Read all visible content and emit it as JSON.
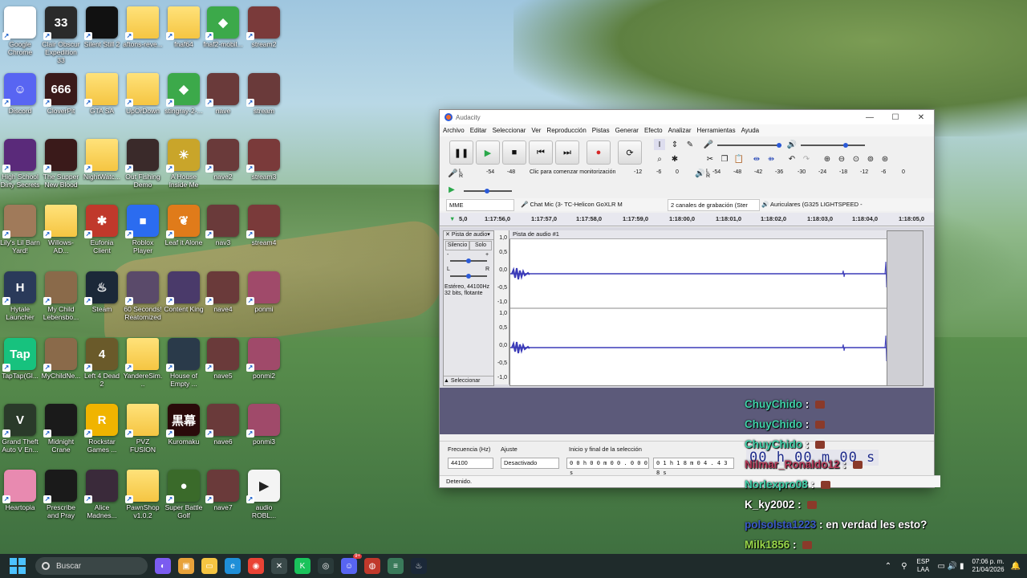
{
  "desktop": {
    "icons": [
      {
        "label": "Google Chrome",
        "color": "#ffffff",
        "glyph": "◉",
        "icon": "chrome-icon"
      },
      {
        "label": "Clair Obscur Expedition 33",
        "color": "#2a2a2a",
        "glyph": "33",
        "icon": "game-icon"
      },
      {
        "label": "Silent Still 2",
        "color": "#111111",
        "glyph": "",
        "icon": "game-icon"
      },
      {
        "label": "aftons-reve...",
        "color": "#f5c542",
        "glyph": "",
        "icon": "folder-icon"
      },
      {
        "label": "fnaf64",
        "color": "#f5c542",
        "glyph": "",
        "icon": "folder-icon"
      },
      {
        "label": "fnaf2-mobil...",
        "color": "#3ca94a",
        "glyph": "◆",
        "icon": "bluestacks-icon"
      },
      {
        "label": "stream2",
        "color": "#7a3a3a",
        "glyph": "",
        "icon": "video-icon"
      },
      {
        "label": "Discord",
        "color": "#5865f2",
        "glyph": "☺",
        "icon": "discord-icon"
      },
      {
        "label": "CloverPit",
        "color": "#3a1a1a",
        "glyph": "666",
        "icon": "game-icon"
      },
      {
        "label": "GTA SA",
        "color": "#f5c542",
        "glyph": "",
        "icon": "folder-icon"
      },
      {
        "label": "UpOrDown",
        "color": "#f5c542",
        "glyph": "",
        "icon": "folder-icon"
      },
      {
        "label": "stingray-2-...",
        "color": "#3ca94a",
        "glyph": "◆",
        "icon": "bluestacks-icon"
      },
      {
        "label": "nave",
        "color": "#6a3a3a",
        "glyph": "",
        "icon": "video-icon"
      },
      {
        "label": "stream",
        "color": "#6a3a3a",
        "glyph": "",
        "icon": "video-icon"
      },
      {
        "label": "High School Dirty Secrets",
        "color": "#5a2a7a",
        "glyph": "",
        "icon": "game-icon"
      },
      {
        "label": "The Supper New Blood",
        "color": "#3a1a1a",
        "glyph": "",
        "icon": "game-icon"
      },
      {
        "label": "NightWatc...",
        "color": "#f5c542",
        "glyph": "",
        "icon": "folder-icon"
      },
      {
        "label": "Out Fishing Demo",
        "color": "#3a2a2a",
        "glyph": "",
        "icon": "game-icon"
      },
      {
        "label": "A House Inside Me",
        "color": "#c9a52a",
        "glyph": "☀",
        "icon": "game-icon"
      },
      {
        "label": "nave2",
        "color": "#6a3a3a",
        "glyph": "",
        "icon": "video-icon"
      },
      {
        "label": "stream3",
        "color": "#7a3a3a",
        "glyph": "",
        "icon": "video-icon"
      },
      {
        "label": "Lily's Lil Barn Yard!",
        "color": "#a07a5a",
        "glyph": "",
        "icon": "game-icon"
      },
      {
        "label": "Willows-AD...",
        "color": "#f5c542",
        "glyph": "",
        "icon": "folder-icon"
      },
      {
        "label": "Eufonia Client",
        "color": "#c0392b",
        "glyph": "✱",
        "icon": "game-icon"
      },
      {
        "label": "Roblox Player",
        "color": "#2b6cf0",
        "glyph": "■",
        "icon": "roblox-icon"
      },
      {
        "label": "Leaf it Alone",
        "color": "#e07b1a",
        "glyph": "❦",
        "icon": "game-icon"
      },
      {
        "label": "nav3",
        "color": "#6a3a3a",
        "glyph": "",
        "icon": "video-icon"
      },
      {
        "label": "stream4",
        "color": "#7a3a3a",
        "glyph": "",
        "icon": "video-icon"
      },
      {
        "label": "Hytale Launcher",
        "color": "#2a3a5a",
        "glyph": "H",
        "icon": "game-icon"
      },
      {
        "label": "My Child Lebensbo...",
        "color": "#8a6a4a",
        "glyph": "",
        "icon": "game-icon"
      },
      {
        "label": "Steam",
        "color": "#1b2838",
        "glyph": "♨",
        "icon": "steam-icon"
      },
      {
        "label": "60 Seconds! Reatomized",
        "color": "#5a4a6a",
        "glyph": "",
        "icon": "game-icon"
      },
      {
        "label": "Content King",
        "color": "#4a3a6a",
        "glyph": "",
        "icon": "game-icon"
      },
      {
        "label": "nave4",
        "color": "#6a3a3a",
        "glyph": "",
        "icon": "video-icon"
      },
      {
        "label": "ponmi",
        "color": "#a04a6a",
        "glyph": "",
        "icon": "video-icon"
      },
      {
        "label": "TapTap(Gl...",
        "color": "#17c27e",
        "glyph": "Tap",
        "icon": "taptap-icon"
      },
      {
        "label": "MyChildNe...",
        "color": "#8a6a4a",
        "glyph": "",
        "icon": "game-icon"
      },
      {
        "label": "Left 4 Dead 2",
        "color": "#6a5a2a",
        "glyph": "4",
        "icon": "game-icon"
      },
      {
        "label": "YandereSim...",
        "color": "#f5c542",
        "glyph": "",
        "icon": "folder-icon"
      },
      {
        "label": "House of Empty ...",
        "color": "#2a3a4a",
        "glyph": "",
        "icon": "game-icon"
      },
      {
        "label": "nave5",
        "color": "#6a3a3a",
        "glyph": "",
        "icon": "video-icon"
      },
      {
        "label": "ponmi2",
        "color": "#a04a6a",
        "glyph": "",
        "icon": "video-icon"
      },
      {
        "label": "Grand Theft Auto V En...",
        "color": "#2a3a2a",
        "glyph": "V",
        "icon": "game-icon"
      },
      {
        "label": "Midnight Crane",
        "color": "#1a1a1a",
        "glyph": "",
        "icon": "game-icon"
      },
      {
        "label": "Rockstar Games ...",
        "color": "#f0b400",
        "glyph": "R",
        "icon": "rockstar-icon"
      },
      {
        "label": "PVZ FUSION",
        "color": "#f5c542",
        "glyph": "",
        "icon": "folder-icon"
      },
      {
        "label": "Kuromaku",
        "color": "#2a0a0a",
        "glyph": "黒幕",
        "icon": "game-icon"
      },
      {
        "label": "nave6",
        "color": "#6a3a3a",
        "glyph": "",
        "icon": "video-icon"
      },
      {
        "label": "ponmi3",
        "color": "#a04a6a",
        "glyph": "",
        "icon": "video-icon"
      },
      {
        "label": "Heartopia",
        "color": "#e88ab0",
        "glyph": "",
        "icon": "game-icon"
      },
      {
        "label": "Prescribe and Pray",
        "color": "#1a1a1a",
        "glyph": "",
        "icon": "game-icon"
      },
      {
        "label": "Alice Madnes...",
        "color": "#3a2a3a",
        "glyph": "",
        "icon": "game-icon"
      },
      {
        "label": "PawnShop v1.0.2",
        "color": "#f5c542",
        "glyph": "",
        "icon": "folder-icon"
      },
      {
        "label": "Super Battle Golf",
        "color": "#3a6a2a",
        "glyph": "●",
        "icon": "game-icon"
      },
      {
        "label": "nave7",
        "color": "#6a3a3a",
        "glyph": "",
        "icon": "video-icon"
      },
      {
        "label": "audio ROBL...",
        "color": "#f4f4f4",
        "glyph": "▶",
        "icon": "audio-file-icon"
      }
    ]
  },
  "audacity": {
    "title": "Audacity",
    "menu": [
      "Archivo",
      "Editar",
      "Seleccionar",
      "Ver",
      "Reproducción",
      "Pistas",
      "Generar",
      "Efecto",
      "Analizar",
      "Herramientas",
      "Ayuda"
    ],
    "meter_ticks_rec": [
      "-54",
      "-48"
    ],
    "monitor_hint": "Clic para comenzar monitorización",
    "meter_ticks_rec2": [
      "-12",
      "-6",
      "0"
    ],
    "meter_ticks_play": [
      "-54",
      "-48",
      "-42",
      "-36",
      "-30",
      "-24",
      "-18",
      "-12",
      "-6",
      "0"
    ],
    "devices": {
      "host": "MME",
      "mic": "Chat Mic (3- TC-Helicon GoXLR M",
      "channels": "2 canales de grabación (Ster",
      "output": "Auriculares (G325 LIGHTSPEED -"
    },
    "timeline": [
      "5,0",
      "1:17:56,0",
      "1:17:57,0",
      "1:17:58,0",
      "1:17:59,0",
      "1:18:00,0",
      "1:18:01,0",
      "1:18:02,0",
      "1:18:03,0",
      "1:18:04,0",
      "1:18:05,0"
    ],
    "track": {
      "menu_label": "Pista de audio",
      "name": "Pista de audio #1",
      "mute": "Silencio",
      "solo": "Solo",
      "gain_minus": "-",
      "gain_plus": "+",
      "pan_l": "L",
      "pan_r": "R",
      "info1": "Estéreo, 44100Hz",
      "info2": "32 bits, flotante",
      "select": "Seleccionar",
      "scale": [
        "1,0",
        "0,5",
        "0,0",
        "-0,5",
        "-1,0"
      ]
    },
    "bottom": {
      "rate_label": "Frecuencia (Hz)",
      "rate_value": "44100",
      "snap_label": "Ajuste",
      "snap_value": "Desactivado",
      "sel_mode": "Inicio y final de la selección",
      "sel_start": "0 0 h 0 0 m 0 0 . 0 0 0 s",
      "sel_end": "0 1 h 1 8 m 0 4 . 4 3 8 s",
      "status": "Detenido."
    }
  },
  "overlay": {
    "timer": "00 h 00 m 00 s",
    "chat": [
      {
        "user": "ChuyChido",
        "color": "#3fd1a8",
        "msg": ""
      },
      {
        "user": "ChuyChido",
        "color": "#3fd1a8",
        "msg": ""
      },
      {
        "user": "ChuyChido",
        "color": "#3fd1a8",
        "msg": ""
      },
      {
        "user": "Nilmar_Ronaldo12",
        "color": "#b83a5a",
        "msg": ""
      },
      {
        "user": "Norlexpro08",
        "color": "#3fd1a8",
        "msg": ""
      },
      {
        "user": "K_ky2002",
        "color": "#ffffff",
        "msg": ""
      },
      {
        "user": "polsolsta1223",
        "color": "#3a5ac8",
        "msg": "en verdad les esto?"
      },
      {
        "user": "Milk1856",
        "color": "#9ad84a",
        "msg": ""
      }
    ]
  },
  "taskbar": {
    "search_placeholder": "Buscar",
    "lang1": "ESP",
    "lang2": "LAA",
    "time": "07:06 p. m.",
    "date": "21/04/2026",
    "discord_badge": "9+",
    "apps": [
      {
        "icon": "copilot-icon",
        "color": "#7b5cf0",
        "glyph": "◐"
      },
      {
        "icon": "widgets-icon",
        "color": "#e8a23a",
        "glyph": "▣"
      },
      {
        "icon": "file-explorer-icon",
        "color": "#f5c542",
        "glyph": "▭"
      },
      {
        "icon": "edge-icon",
        "color": "#1f8fd8",
        "glyph": "e"
      },
      {
        "icon": "chrome-icon",
        "color": "#e94335",
        "glyph": "◉"
      },
      {
        "icon": "capture-icon",
        "color": "#3a4a4a",
        "glyph": "✕"
      },
      {
        "icon": "app-green-icon",
        "color": "#1ac35b",
        "glyph": "K"
      },
      {
        "icon": "app-badge-icon",
        "color": "#2a3a3a",
        "glyph": "◎"
      },
      {
        "icon": "discord-icon",
        "color": "#5865f2",
        "glyph": "☺"
      },
      {
        "icon": "app-red-icon",
        "color": "#c0392b",
        "glyph": "◍"
      },
      {
        "icon": "app-stack-icon",
        "color": "#3a7a5a",
        "glyph": "≡"
      },
      {
        "icon": "steam-icon",
        "color": "#1b2838",
        "glyph": "♨"
      }
    ]
  }
}
